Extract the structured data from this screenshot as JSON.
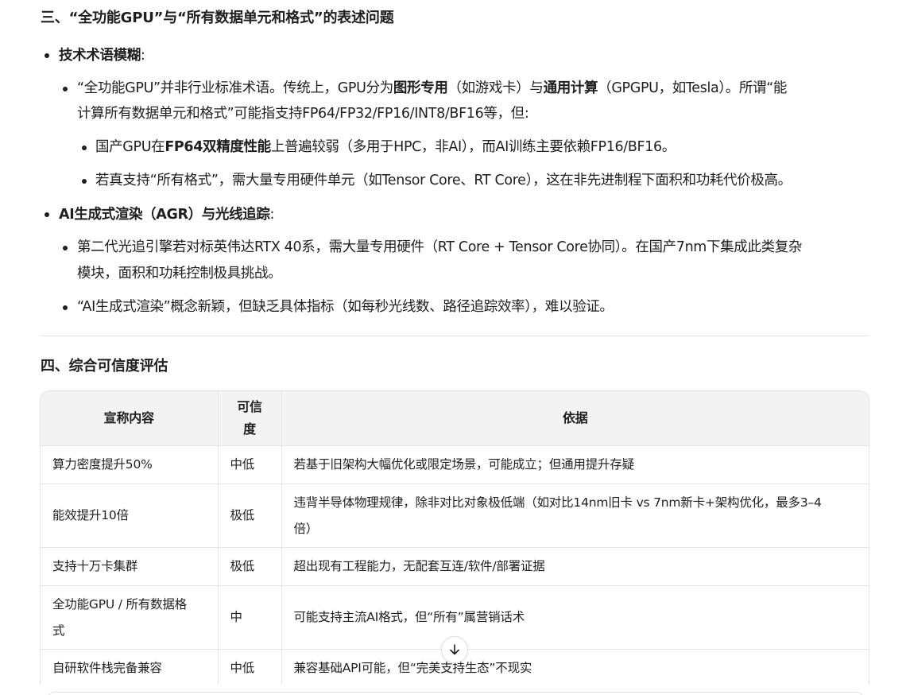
{
  "section3": {
    "heading": "三、“全功能GPU”与“所有数据单元和格式”的表述问题",
    "b1": {
      "title": "技术术语模糊",
      "colon": ":",
      "p1": {
        "t1": "“全功能GPU”并非行业标准术语。传统上，GPU分为",
        "b1": "图形专用",
        "t2": "（如游戏卡）与",
        "b2": "通用计算",
        "t3": "（GPGPU，如Tesla）。所谓“能",
        "line2": "计算所有数据单元和格式”可能指支持FP64/FP32/FP16/INT8/BF16等，但:"
      },
      "s1": {
        "t1": "国产GPU在",
        "b1": "FP64双精度性能",
        "t2": "上普遍较弱（多用于HPC，非AI），而AI训练主要依赖FP16/BF16。"
      },
      "s2": "若真支持“所有格式”，需大量专用硬件单元（如Tensor Core、RT Core），这在非先进制程下面积和功耗代价极高。"
    },
    "b2": {
      "title": "AI生成式渲染（AGR）与光线追踪",
      "colon": ":",
      "p1": {
        "line1": "第二代光追引擎若对标英伟达RTX 40系，需大量专用硬件（RT Core + Tensor Core协同）。在国产7nm下集成此类复杂",
        "line2": "模块，面积和功耗控制极具挑战。"
      },
      "p2": "“AI生成式渲染”概念新颖，但缺乏具体指标（如每秒光线数、路径追踪效率），难以验证。"
    }
  },
  "section4": {
    "heading": "四、综合可信度评估",
    "table": {
      "headers": {
        "claim": "宣称内容",
        "cred_line1": "可信",
        "cred_line2": "度",
        "basis": "依据"
      },
      "rows": [
        {
          "claim": "算力密度提升50%",
          "cred": "中低",
          "basis": "若基于旧架构大幅优化或限定场景，可能成立；但通用提升存疑"
        },
        {
          "claim": "能效提升10倍",
          "cred": "极低",
          "basis_line1": "违背半导体物理规律，除非对比对象极低端（如对比14nm旧卡 vs 7nm新卡+架构优化，最多3–4",
          "basis_line2": "倍）"
        },
        {
          "claim": "支持十万卡集群",
          "cred": "极低",
          "basis": "超出现有工程能力，无配套互连/软件/部署证据"
        },
        {
          "claim_line1": "全功能GPU / 所有数据格",
          "claim_line2": "式",
          "cred": "中",
          "basis": "可能支持主流AI格式，但“所有”属营销话术"
        },
        {
          "claim": "自研软件栈完备兼容",
          "cred": "中低",
          "basis": "兼容基础API可能，但“完美支持生态”不现实"
        }
      ]
    }
  },
  "scroll_button": {
    "icon": "arrow-down-icon"
  }
}
